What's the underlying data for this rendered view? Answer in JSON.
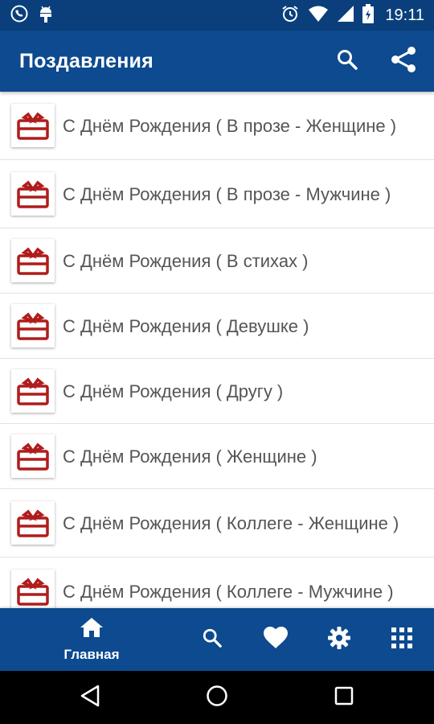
{
  "status_bar": {
    "time": "19:11",
    "icons": [
      "viber-icon",
      "android-debug-icon",
      "alarm-icon",
      "wifi-icon",
      "signal-icon",
      "battery-icon"
    ]
  },
  "app_bar": {
    "title": "Поздавления",
    "actions": [
      "search-icon",
      "share-icon"
    ],
    "color": "#0d4a8f"
  },
  "list": {
    "items": [
      {
        "label": "С Днём Рождения ( В прозе - Женщине )",
        "icon": "birthday-cake-icon"
      },
      {
        "label": "С Днём Рождения ( В прозе - Мужчине )",
        "icon": "birthday-cake-icon"
      },
      {
        "label": "С Днём Рождения ( В стихах )",
        "icon": "birthday-cake-icon"
      },
      {
        "label": "С Днём Рождения ( Девушке )",
        "icon": "birthday-cake-icon"
      },
      {
        "label": "С Днём Рождения ( Другу )",
        "icon": "birthday-cake-icon"
      },
      {
        "label": "С Днём Рождения ( Женщине )",
        "icon": "birthday-cake-icon"
      },
      {
        "label": "С Днём Рождения ( Коллеге - Женщине )",
        "icon": "birthday-cake-icon"
      },
      {
        "label": "С Днём Рождения ( Коллеге - Мужчине )",
        "icon": "birthday-cake-icon"
      }
    ],
    "icon_color": "#b01c1c"
  },
  "bottom_nav": {
    "home_label": "Главная",
    "items": [
      "home-icon",
      "search-icon",
      "heart-icon",
      "settings-icon",
      "apps-grid-icon"
    ],
    "active": "home"
  },
  "system_nav": {
    "buttons": [
      "back-icon",
      "home-circle-icon",
      "recents-icon"
    ]
  }
}
